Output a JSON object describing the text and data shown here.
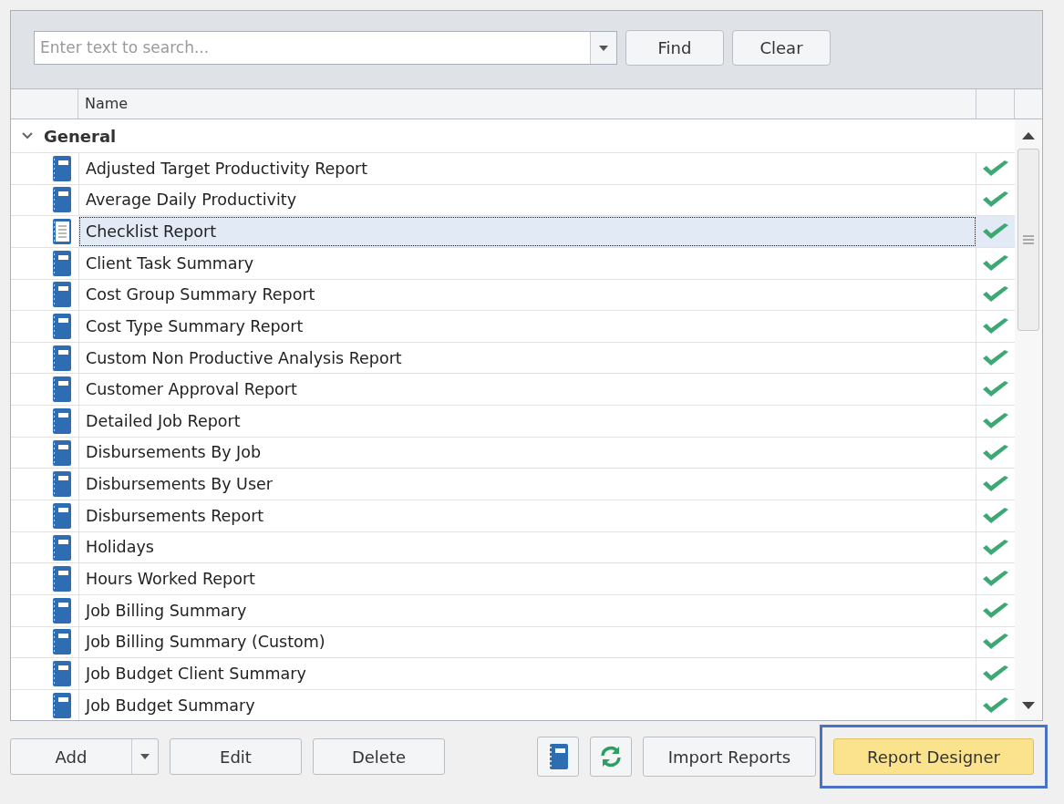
{
  "search": {
    "placeholder": "Enter text to search..."
  },
  "search_buttons": [
    "Find",
    "Clear"
  ],
  "table": {
    "columns": [
      "Name"
    ],
    "group": {
      "label": "General",
      "expanded": true
    },
    "rows": [
      {
        "name": "Adjusted Target Productivity Report",
        "kind": "report",
        "selected": false,
        "checked": true
      },
      {
        "name": "Average Daily Productivity",
        "kind": "report",
        "selected": false,
        "checked": true
      },
      {
        "name": "Checklist Report",
        "kind": "checklist",
        "selected": true,
        "checked": true
      },
      {
        "name": "Client Task Summary",
        "kind": "report",
        "selected": false,
        "checked": true
      },
      {
        "name": "Cost Group Summary Report",
        "kind": "report",
        "selected": false,
        "checked": true
      },
      {
        "name": "Cost Type Summary Report",
        "kind": "report",
        "selected": false,
        "checked": true
      },
      {
        "name": "Custom Non Productive Analysis Report",
        "kind": "report",
        "selected": false,
        "checked": true
      },
      {
        "name": "Customer Approval Report",
        "kind": "report",
        "selected": false,
        "checked": true
      },
      {
        "name": "Detailed Job Report",
        "kind": "report",
        "selected": false,
        "checked": true
      },
      {
        "name": "Disbursements By Job",
        "kind": "report",
        "selected": false,
        "checked": true
      },
      {
        "name": "Disbursements By User",
        "kind": "report",
        "selected": false,
        "checked": true
      },
      {
        "name": "Disbursements Report",
        "kind": "report",
        "selected": false,
        "checked": true
      },
      {
        "name": "Holidays",
        "kind": "report",
        "selected": false,
        "checked": true
      },
      {
        "name": "Hours Worked Report",
        "kind": "report",
        "selected": false,
        "checked": true
      },
      {
        "name": "Job Billing Summary",
        "kind": "report",
        "selected": false,
        "checked": true
      },
      {
        "name": "Job Billing Summary (Custom)",
        "kind": "report",
        "selected": false,
        "checked": true
      },
      {
        "name": "Job Budget Client Summary",
        "kind": "report",
        "selected": false,
        "checked": true
      },
      {
        "name": "Job Budget Summary",
        "kind": "report",
        "selected": false,
        "checked": true
      }
    ]
  },
  "bottom_buttons": [
    {
      "label": "Add"
    },
    {
      "label": "Edit"
    },
    {
      "label": "Delete"
    }
  ],
  "import_button": "Import Reports",
  "designer_button": {
    "label": "Report Designer",
    "highlighted": true
  }
}
